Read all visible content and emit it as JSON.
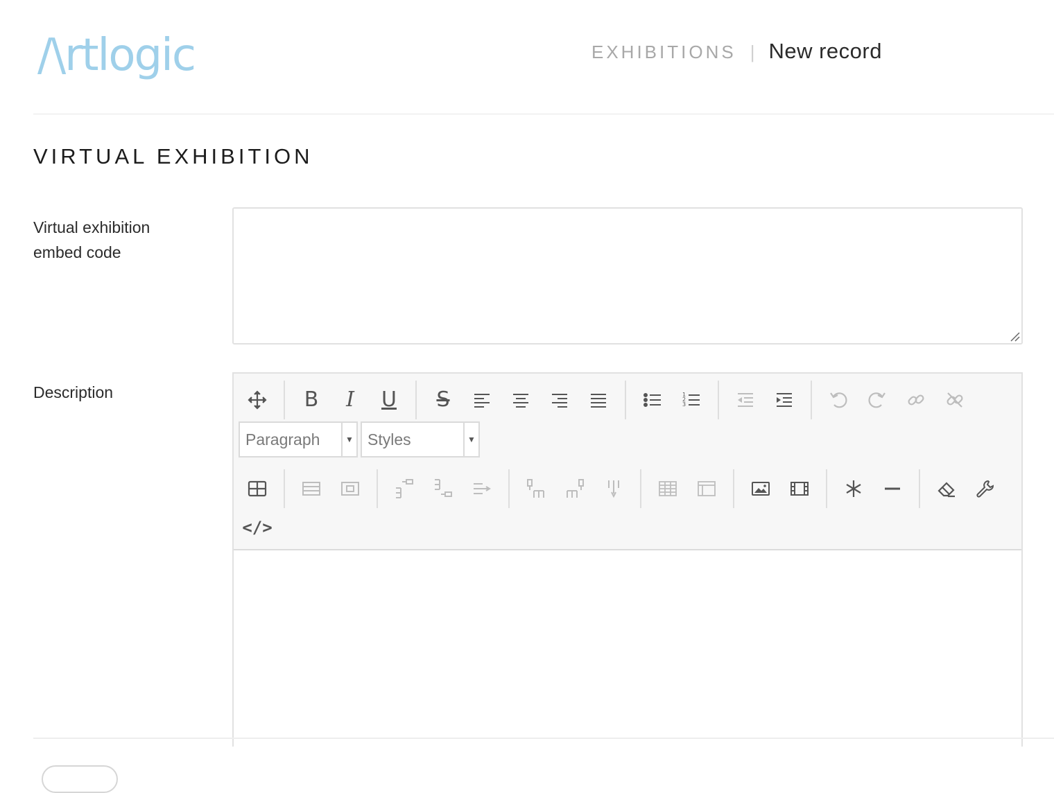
{
  "app": {
    "logo_text": "/\\rtlogic"
  },
  "breadcrumb": {
    "section": "EXHIBITIONS",
    "separator": "|",
    "current": "New record"
  },
  "section": {
    "title": "VIRTUAL EXHIBITION"
  },
  "fields": {
    "embed_code": {
      "label": "Virtual exhibition embed code",
      "value": ""
    },
    "description": {
      "label": "Description",
      "value": ""
    }
  },
  "editor": {
    "toolbar_row1": [
      {
        "name": "move-icon",
        "disabled": false
      },
      {
        "name": "bold-icon",
        "text": "B",
        "disabled": false
      },
      {
        "name": "italic-icon",
        "text": "I",
        "disabled": false
      },
      {
        "name": "underline-icon",
        "text": "U",
        "disabled": false
      },
      {
        "name": "strikethrough-icon",
        "text": "S",
        "disabled": false
      },
      {
        "name": "align-left-icon",
        "disabled": false
      },
      {
        "name": "align-center-icon",
        "disabled": false
      },
      {
        "name": "align-right-icon",
        "disabled": false
      },
      {
        "name": "align-justify-icon",
        "disabled": false
      },
      {
        "name": "bullet-list-icon",
        "disabled": false
      },
      {
        "name": "numbered-list-icon",
        "disabled": false
      },
      {
        "name": "outdent-icon",
        "disabled": true
      },
      {
        "name": "indent-icon",
        "disabled": false
      },
      {
        "name": "undo-icon",
        "disabled": true
      },
      {
        "name": "redo-icon",
        "disabled": true
      },
      {
        "name": "link-icon",
        "disabled": true
      },
      {
        "name": "unlink-icon",
        "disabled": true
      }
    ],
    "block_format": {
      "selected": "Paragraph"
    },
    "styles": {
      "selected": "Styles"
    },
    "toolbar_row3": [
      {
        "name": "table-icon",
        "disabled": false
      },
      {
        "name": "table-row-props-icon",
        "disabled": true
      },
      {
        "name": "table-cell-props-icon",
        "disabled": true
      },
      {
        "name": "insert-row-before-icon",
        "disabled": true
      },
      {
        "name": "insert-row-after-icon",
        "disabled": true
      },
      {
        "name": "delete-row-icon",
        "disabled": true
      },
      {
        "name": "insert-col-before-icon",
        "disabled": true
      },
      {
        "name": "insert-col-after-icon",
        "disabled": true
      },
      {
        "name": "delete-col-icon",
        "disabled": true
      },
      {
        "name": "table-props-icon",
        "disabled": true
      },
      {
        "name": "delete-table-icon",
        "disabled": true
      },
      {
        "name": "image-icon",
        "disabled": false
      },
      {
        "name": "media-icon",
        "disabled": false
      },
      {
        "name": "special-char-icon",
        "disabled": false
      },
      {
        "name": "horizontal-rule-icon",
        "disabled": false
      },
      {
        "name": "clear-format-icon",
        "disabled": false
      },
      {
        "name": "settings-wrench-icon",
        "disabled": false
      },
      {
        "name": "source-code-icon",
        "text": "</>",
        "disabled": false
      }
    ]
  }
}
